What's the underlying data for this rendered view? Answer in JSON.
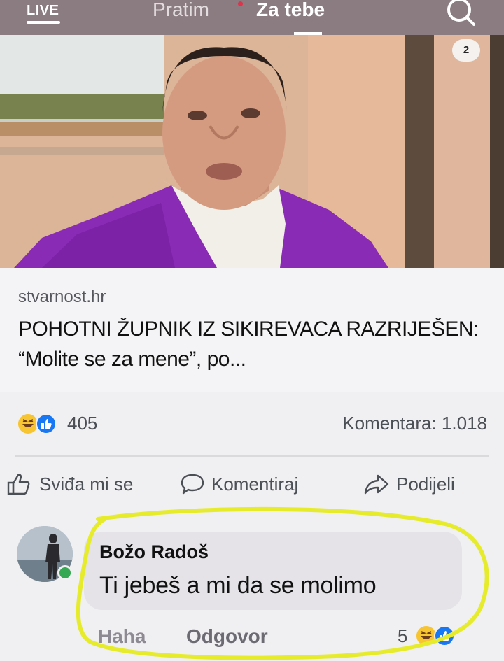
{
  "topbar": {
    "live_label": "LIVE",
    "tabs": [
      {
        "label": "Pratim",
        "active": false,
        "has_notification_dot": true
      },
      {
        "label": "Za tebe",
        "active": true
      }
    ],
    "search_icon": "search-icon"
  },
  "hero": {
    "badge_label": "2"
  },
  "article": {
    "source": "stvarnost.hr",
    "headline": "POHOTNI ŽUPNIK IZ SIKIREVACA RAZRIJEŠEN: “Molite se za mene”, po..."
  },
  "stats": {
    "reactions": [
      "haha-icon",
      "like-icon"
    ],
    "reaction_count": "405",
    "comment_count": "Komentara: 1.018"
  },
  "actions": {
    "like_label": "Sviđa mi se",
    "comment_label": "Komentiraj",
    "share_label": "Podijeli"
  },
  "comment": {
    "author": "Božo Radoš",
    "text": "Ti jebeš a mi da se molimo",
    "haha_label": "Haha",
    "reply_label": "Odgovor",
    "reaction_count": "5",
    "reactions": [
      "haha-icon",
      "like-icon"
    ]
  },
  "colors": {
    "highlight": "#e6ec2c",
    "like_blue": "#1877f2",
    "haha_yellow": "#f7c531",
    "online_green": "#35a853",
    "topbar": "#8b7c81",
    "vestment_purple": "#8a2bb5"
  }
}
